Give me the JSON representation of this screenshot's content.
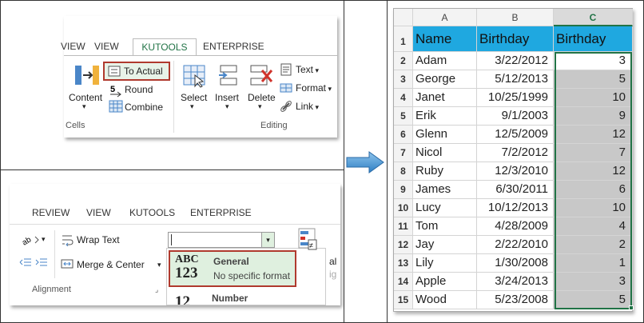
{
  "top_ribbon": {
    "tabs": [
      "VIEW",
      "VIEW",
      "KUTOOLS",
      "ENTERPRISE"
    ],
    "to_actual": "To Actual",
    "round": "Round",
    "combine": "Combine",
    "content": "Content",
    "select": "Select",
    "insert": "Insert",
    "delete": "Delete",
    "text": "Text",
    "format": "Format",
    "link": "Link",
    "group_cells": "Cells",
    "group_editing": "Editing",
    "accent": "#217346",
    "highlight_border": "#b03a2e"
  },
  "bottom_ribbon": {
    "tabs": [
      "REVIEW",
      "VIEW",
      "KUTOOLS",
      "ENTERPRISE"
    ],
    "wrap_text": "Wrap Text",
    "merge_center": "Merge & Center",
    "alignment": "Alignment",
    "general_title": "General",
    "general_sub": "No specific format",
    "general_icon_top": "ABC",
    "general_icon_bottom": "123",
    "number_title": "Number",
    "number_icon": "12",
    "cut_text_1": "al",
    "cut_text_2": "ig"
  },
  "sheet": {
    "columns": [
      "A",
      "B",
      "C"
    ],
    "headers": [
      "Name",
      "Birthday",
      "Birthday"
    ],
    "rows": [
      {
        "num": "2",
        "name": "Adam",
        "birthday": "3/22/2012",
        "value": "3"
      },
      {
        "num": "3",
        "name": "George",
        "birthday": "5/12/2013",
        "value": "5"
      },
      {
        "num": "4",
        "name": "Janet",
        "birthday": "10/25/1999",
        "value": "10"
      },
      {
        "num": "5",
        "name": "Erik",
        "birthday": "9/1/2003",
        "value": "9"
      },
      {
        "num": "6",
        "name": "Glenn",
        "birthday": "12/5/2009",
        "value": "12"
      },
      {
        "num": "7",
        "name": "Nicol",
        "birthday": "7/2/2012",
        "value": "7"
      },
      {
        "num": "8",
        "name": "Ruby",
        "birthday": "12/3/2010",
        "value": "12"
      },
      {
        "num": "9",
        "name": "James",
        "birthday": "6/30/2011",
        "value": "6"
      },
      {
        "num": "10",
        "name": "Lucy",
        "birthday": "10/12/2013",
        "value": "10"
      },
      {
        "num": "11",
        "name": "Tom",
        "birthday": "4/28/2009",
        "value": "4"
      },
      {
        "num": "12",
        "name": "Jay",
        "birthday": "2/22/2010",
        "value": "2"
      },
      {
        "num": "13",
        "name": "Lily",
        "birthday": "1/30/2008",
        "value": "1"
      },
      {
        "num": "14",
        "name": "Apple",
        "birthday": "3/24/2013",
        "value": "3"
      },
      {
        "num": "15",
        "name": "Wood",
        "birthday": "5/23/2008",
        "value": "5"
      }
    ],
    "header_row_num": "1",
    "header_color": "#1fa8e0",
    "selected_fill": "#c8c8c8",
    "selection_border": "#217346"
  }
}
